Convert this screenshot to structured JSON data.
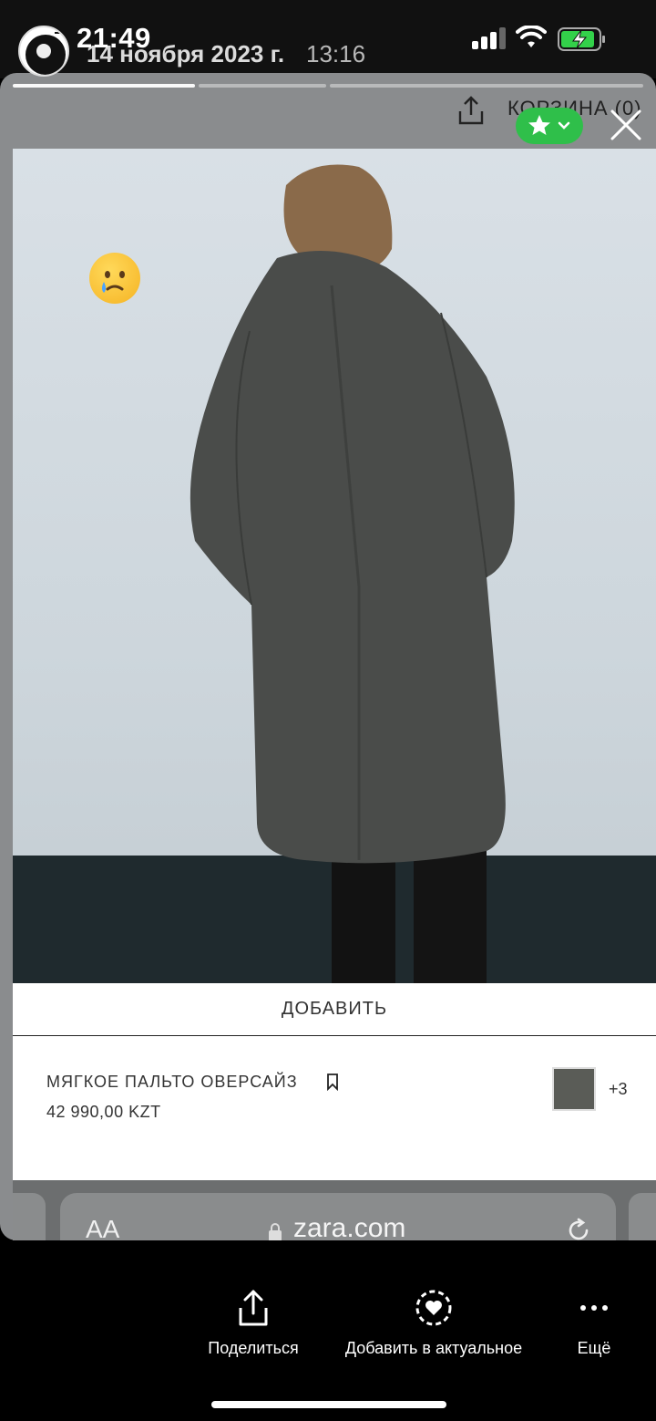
{
  "status_bar": {
    "time": "21:49",
    "icons": [
      "signal-icon",
      "wifi-icon",
      "battery-charging-icon"
    ]
  },
  "story": {
    "progress_segments": 3,
    "current_segment": 1,
    "date": "14 ноября 2023 г.",
    "time": "13:16",
    "sticker": "crying-face-emoji",
    "icons": [
      "avatar",
      "share-icon",
      "star-icon",
      "chevron-down-icon",
      "close-icon"
    ],
    "colors": {
      "fav_pill": "#2fbf4a"
    }
  },
  "site_header": {
    "cart_label": "КОРЗИНА (0)"
  },
  "product": {
    "add_button": "ДОБАВИТЬ",
    "name": "МЯГКОЕ ПАЛЬТО ОВЕРСАЙЗ",
    "price": "42 990,00 KZT",
    "swatch_color": "#5a5c57",
    "more_colors": "+3",
    "icons": [
      "bookmark-icon"
    ]
  },
  "browser": {
    "text_size_label": "AA",
    "url": "zara.com",
    "icons": [
      "lock-icon",
      "reload-icon"
    ]
  },
  "actions": [
    {
      "label": "Поделиться",
      "icon": "share-icon"
    },
    {
      "label": "Добавить в актуальное",
      "icon": "highlight-heart-icon"
    },
    {
      "label": "Ещё",
      "icon": "more-icon"
    }
  ]
}
